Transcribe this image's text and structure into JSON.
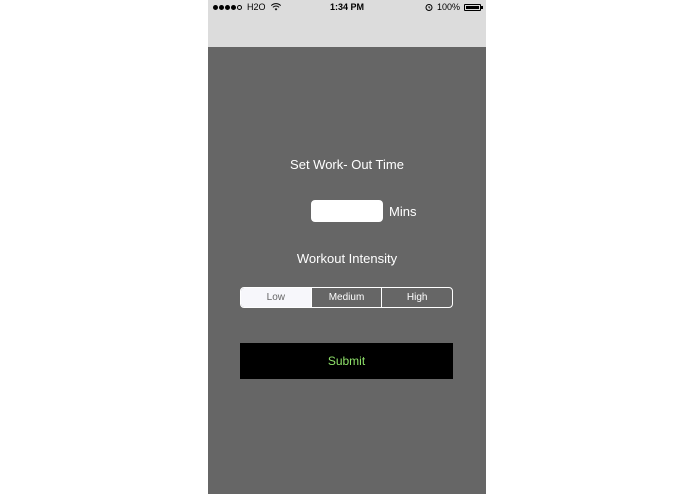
{
  "status_bar": {
    "carrier": "H2O",
    "time": "1:34 PM",
    "battery": "100%",
    "signal_icon": "signal-dots-icon",
    "wifi_icon": "wifi-icon",
    "alarm_icon": "alarm-icon",
    "battery_icon": "battery-icon"
  },
  "form": {
    "title": "Set Work- Out Time",
    "time_value": "",
    "time_unit": "Mins",
    "intensity_label": "Workout Intensity",
    "intensity_options": [
      "Low",
      "Medium",
      "High"
    ],
    "selected_intensity": "Low",
    "submit_label": "Submit"
  },
  "colors": {
    "background": "#666666",
    "status_bar": "#dcdcdc",
    "submit_text": "#8fe26a",
    "submit_bg": "#000000"
  }
}
